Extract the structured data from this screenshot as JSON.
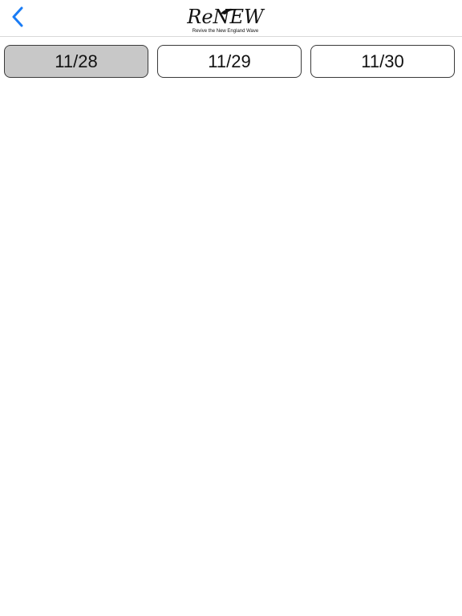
{
  "nav": {
    "back_icon": "chevron-left-icon",
    "accent_color": "#1a7cf5",
    "logo": {
      "word": "ReNEW",
      "tagline": "Revive the New England Wave"
    }
  },
  "tabs": [
    {
      "label": "11/28",
      "selected": true
    },
    {
      "label": "11/29",
      "selected": false
    },
    {
      "label": "11/30",
      "selected": false
    }
  ]
}
